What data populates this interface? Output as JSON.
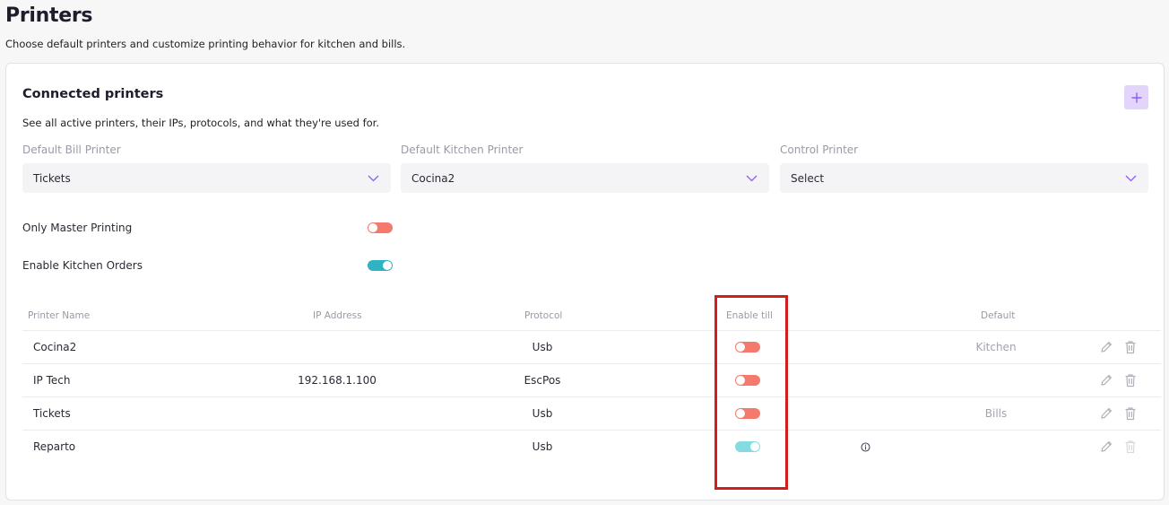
{
  "page": {
    "title": "Printers",
    "subtitle": "Choose default printers and customize printing behavior for kitchen and bills."
  },
  "card": {
    "title": "Connected printers",
    "subtitle": "See all active printers, their IPs, protocols, and what they're used for.",
    "add_icon": "plus-icon"
  },
  "defaults": {
    "bill": {
      "label": "Default Bill Printer",
      "value": "Tickets"
    },
    "kitchen": {
      "label": "Default Kitchen Printer",
      "value": "Cocina2"
    },
    "control": {
      "label": "Control Printer",
      "value": "Select"
    }
  },
  "settings": {
    "master": {
      "label": "Only Master Printing",
      "enabled": false
    },
    "kitchen_orders": {
      "label": "Enable Kitchen Orders",
      "enabled": true
    }
  },
  "table": {
    "headers": {
      "name": "Printer Name",
      "ip": "IP Address",
      "protocol": "Protocol",
      "till": "Enable till",
      "default": "Default"
    },
    "rows": [
      {
        "name": "Cocina2",
        "ip": "",
        "protocol": "Usb",
        "till": false,
        "default": "Kitchen"
      },
      {
        "name": "IP Tech",
        "ip": "192.168.1.100",
        "protocol": "EscPos",
        "till": false,
        "default": ""
      },
      {
        "name": "Tickets",
        "ip": "",
        "protocol": "Usb",
        "till": false,
        "default": "Bills"
      },
      {
        "name": "Reparto",
        "ip": "",
        "protocol": "Usb",
        "till": true,
        "default": ""
      }
    ]
  },
  "colors": {
    "accent_purple": "#8b5cf6",
    "toggle_off": "#f47a6e",
    "toggle_on": "#2fb3c2",
    "highlight": "#d31d1d"
  }
}
